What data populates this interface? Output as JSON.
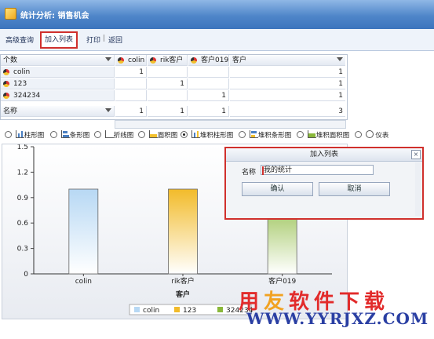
{
  "window": {
    "title": "统计分析: 销售机会"
  },
  "toolbar": {
    "advanced_query": "高级查询",
    "add_list": "加入列表",
    "print": "打印",
    "sep": "|",
    "back": "返回"
  },
  "grid": {
    "row_dim": "个数",
    "col_headers": [
      "colin",
      "rik客户",
      "客户019",
      "客户"
    ],
    "rows": [
      {
        "label": "colin",
        "values": [
          "1",
          "",
          "",
          "1"
        ]
      },
      {
        "label": "123",
        "values": [
          "",
          "1",
          "",
          "1"
        ]
      },
      {
        "label": "324234",
        "values": [
          "",
          "",
          "1",
          "1"
        ]
      }
    ],
    "footer": {
      "label": "名称",
      "values": [
        "1",
        "1",
        "1",
        "3"
      ]
    }
  },
  "chart_types": [
    "柱形图",
    "条形图",
    "折线图",
    "面积图",
    "堆积柱形图",
    "堆积条形图",
    "堆积面积图",
    "仪表"
  ],
  "chart_types_selected": 4,
  "chart_data": {
    "type": "bar",
    "xlabel": "客户",
    "ylabel": "",
    "ylim": [
      0,
      1.5
    ],
    "yticks": [
      "0",
      "0.3",
      "0.6",
      "0.9",
      "1.2",
      "1.5"
    ],
    "categories": [
      "colin",
      "rik客户",
      "客户019"
    ],
    "series": [
      {
        "name": "colin",
        "values": [
          1,
          0,
          0
        ],
        "color": "#b7d8f4"
      },
      {
        "name": "123",
        "values": [
          0,
          1,
          0
        ],
        "color": "#f2bb2a"
      },
      {
        "name": "324234",
        "values": [
          0,
          0,
          1
        ],
        "color": "#8ab83a"
      }
    ],
    "legend": [
      "colin",
      "123",
      "324234"
    ]
  },
  "dialog": {
    "title": "加入列表",
    "name_label": "名称",
    "name_value": "我的统计",
    "confirm": "确认",
    "cancel": "取消",
    "close": "×"
  },
  "watermark": {
    "line1_a": "用",
    "line1_b": "友",
    "line1_c": "软件下载",
    "line2": "WWW.YYRJXZ.COM"
  },
  "colors": {
    "accent": "#d0302c",
    "title_bar": "#4f86c9"
  }
}
